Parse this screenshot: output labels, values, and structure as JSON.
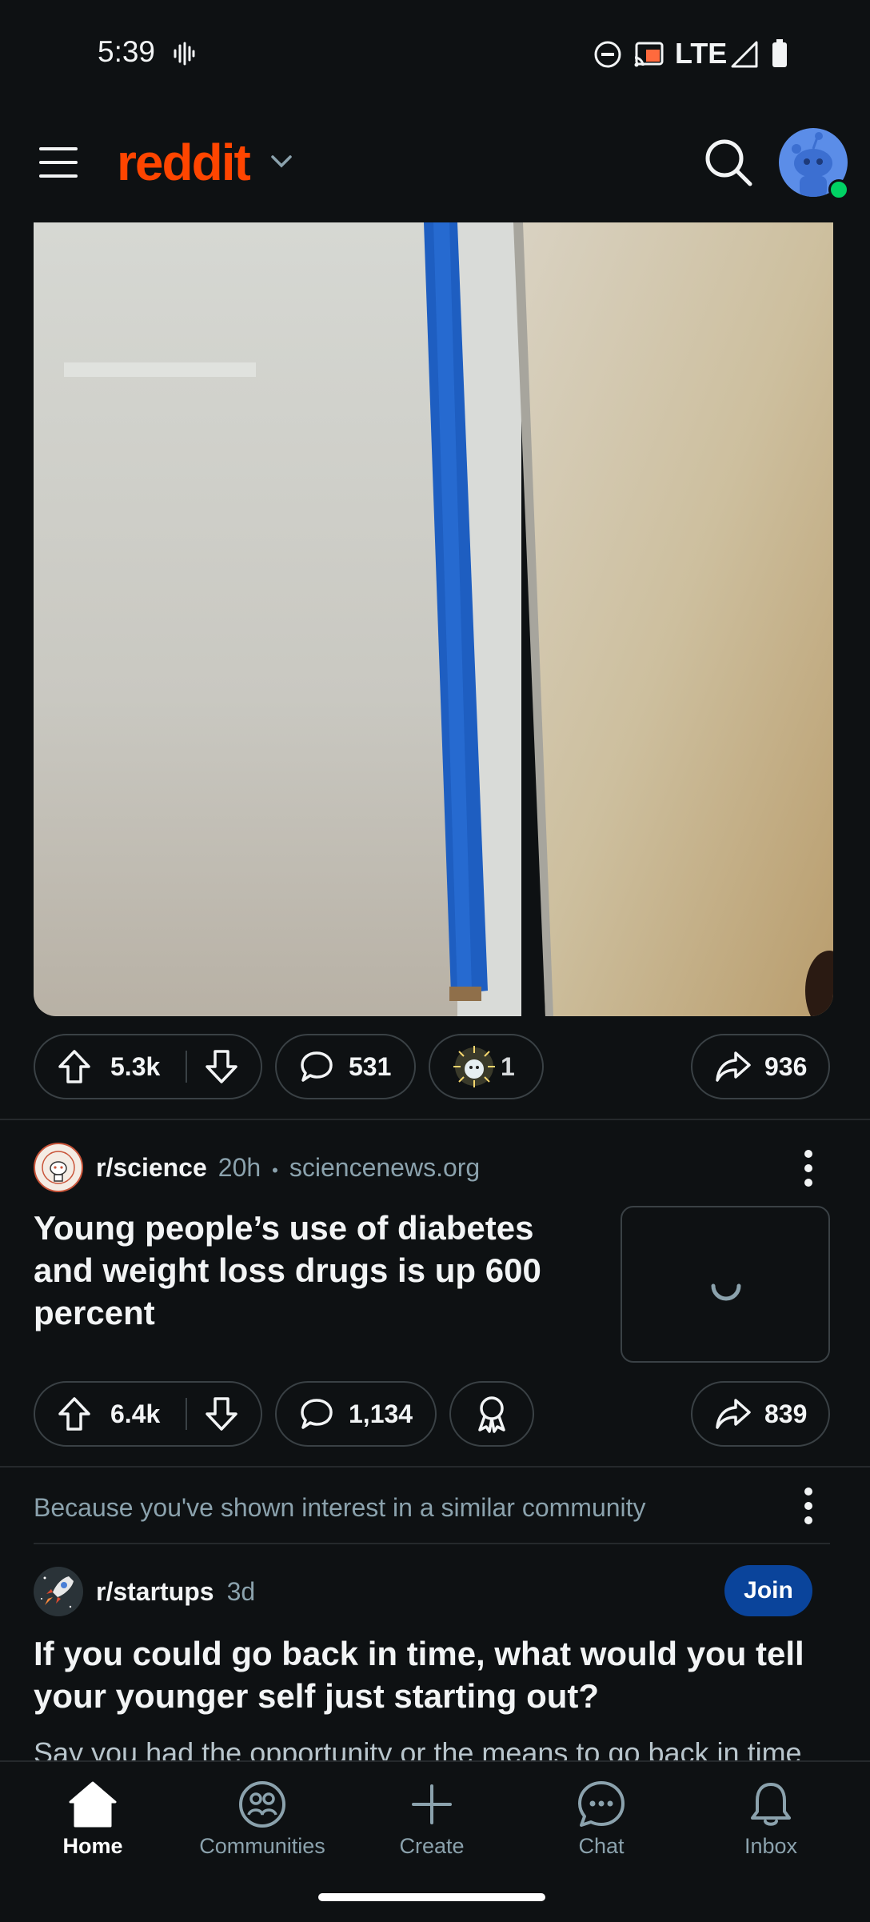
{
  "status_bar": {
    "time": "5:39",
    "network": "LTE"
  },
  "header": {
    "logo_text": "reddit"
  },
  "post1": {
    "upvotes": "5.3k",
    "comments": "531",
    "awards": "1",
    "shares": "936"
  },
  "post2": {
    "subreddit": "r/science",
    "age": "20h",
    "separator": "•",
    "domain": "sciencenews.org",
    "title": "Young people’s use of diabetes and weight loss drugs is up 600 percent",
    "upvotes": "6.4k",
    "comments": "1,134",
    "shares": "839"
  },
  "recommendation": {
    "reason": "Because you've shown interest in a similar community"
  },
  "post3": {
    "subreddit": "r/startups",
    "age": "3d",
    "join_label": "Join",
    "title": "If you could go back in time, what would you tell your younger self just starting out?",
    "body_preview": "Say you had the opportunity or the means to go back in time"
  },
  "bottom_nav": {
    "home": "Home",
    "communities": "Communities",
    "create": "Create",
    "chat": "Chat",
    "inbox": "Inbox"
  },
  "colors": {
    "brand": "#ff4500",
    "join": "#0a449b",
    "background": "#0e1113"
  }
}
